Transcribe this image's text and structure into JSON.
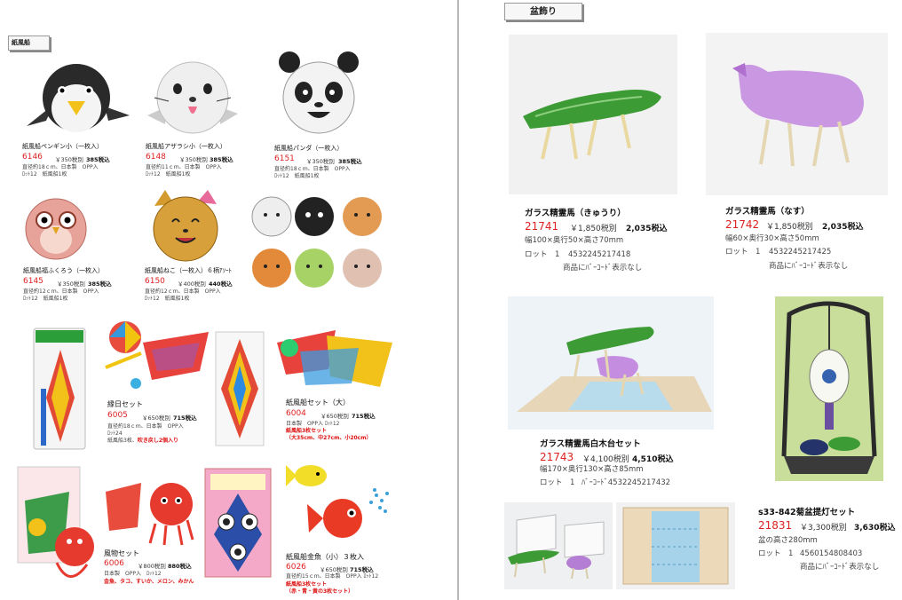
{
  "left": {
    "section_label": "紙風船",
    "products": [
      {
        "name": "紙風船ペンギン小（一枚入）",
        "code": "6146",
        "price_ex": "￥350税別",
        "price_in": "385税込",
        "spec1": "直径約18ｃｍ、日本製　OPP入",
        "spec2": "ﾛｯﾄ12　紙風船1枚"
      },
      {
        "name": "紙風船アザラシ小（一枚入）",
        "code": "6148",
        "price_ex": "￥350税別",
        "price_in": "385税込",
        "spec1": "直径約11ｃｍ、日本製　OPP入",
        "spec2": "ﾛｯﾄ12　紙風船1枚"
      },
      {
        "name": "紙風船パンダ（一枚入）",
        "code": "6151",
        "price_ex": "￥350税別",
        "price_in": "385税込",
        "spec1": "直径約18ｃｍ、日本製　OPP入",
        "spec2": "ﾛｯﾄ12　紙風船1枚"
      },
      {
        "name": "紙風船福ふくろう（一枚入）",
        "code": "6145",
        "price_ex": "￥350税別",
        "price_in": "385税込",
        "spec1": "直径約12ｃｍ、日本製　OPP入",
        "spec2": "ﾛｯﾄ12　紙風船1枚"
      },
      {
        "name": "紙風船ねこ（一枚入）６柄ｱｿｰﾄ",
        "code": "6150",
        "price_ex": "￥400税別",
        "price_in": "440税込",
        "spec1": "直径約12ｃｍ、日本製　OPP入",
        "spec2": "ﾛｯﾄ12　紙風船1枚"
      },
      {
        "name": "縁日セット",
        "code": "6005",
        "price_ex": "￥650税別",
        "price_in": "715税込",
        "spec1": "直径約18ｃｍ、日本製　OPP入",
        "spec2": "ﾛｯﾄ24",
        "spec3": "紙風船3枚、",
        "note_red": "吹き戻し2個入り"
      },
      {
        "name": "紙風船セット（大）",
        "code": "6004",
        "price_ex": "￥650税別",
        "price_in": "715税込",
        "spec1": "日本製　OPP入 ﾛｯﾄ12",
        "note_red1": "紙風船3枚セット",
        "note_red2": "（大35cm、中27cm、小20cm）"
      },
      {
        "name": "風物セット",
        "code": "6006",
        "price_ex": "￥800税別",
        "price_in": "880税込",
        "spec1": "日本製　OPP入　ﾛｯﾄ12",
        "note_red": "金魚、タコ、すいか、メロン、みかん"
      },
      {
        "name": "紙風船金魚（小）３枚入",
        "code": "6026",
        "price_ex": "￥650税別",
        "price_in": "715税込",
        "spec1": "直径約15ｃｍ、日本製　OPP入 ﾛｯﾄ12",
        "note_red1": "紙風船3枚セット",
        "note_red2": "（赤・青・黄の3枚セット）"
      }
    ]
  },
  "right": {
    "section_label": "盆飾り",
    "products": [
      {
        "name": "ガラス精霊馬（きゅうり）",
        "code": "21741",
        "price_ex": "￥1,850税別",
        "price_in": "2,035税込",
        "spec1": "幅100×奥行50×高さ70mm",
        "lot": "ロット　1",
        "jan": "4532245217418",
        "barcode_note": "商品にﾊﾞｰｺｰﾄﾞ表示なし"
      },
      {
        "name": "ガラス精霊馬（なす）",
        "code": "21742",
        "price_ex": "￥1,850税別",
        "price_in": "2,035税込",
        "spec1": "幅60×奥行30×高さ50mm",
        "lot": "ロット　1",
        "jan": "4532245217425",
        "barcode_note": "商品にﾊﾞｰｺｰﾄﾞ表示なし"
      },
      {
        "name": "ガラス精霊馬白木台セット",
        "code": "21743",
        "price_ex": "￥4,100税別",
        "price_in": "4,510税込",
        "spec1": "幅170×奥行130×高さ85mm",
        "lot": "ロット　1",
        "jan": "ﾊﾞｰｺｰﾄﾞ4532245217432"
      },
      {
        "name": "s33-842菊盆提灯セット",
        "code": "21831",
        "price_ex": "￥3,300税別",
        "price_in": "3,630税込",
        "spec1": "盆の高さ280mm",
        "lot": "ロット　1",
        "jan": "4560154808403",
        "barcode_note": "商品にﾊﾞｰｺｰﾄﾞ表示なし"
      }
    ]
  }
}
